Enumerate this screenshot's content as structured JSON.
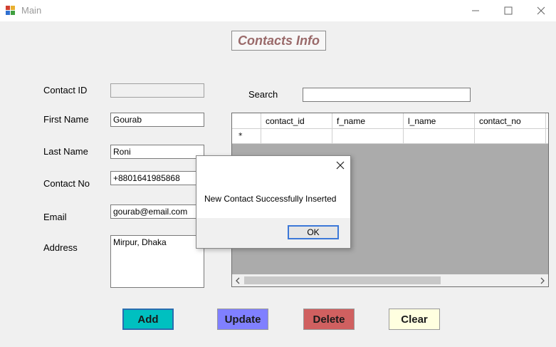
{
  "window": {
    "title": "Main"
  },
  "header": {
    "title": "Contacts Info"
  },
  "form": {
    "contact_id": {
      "label": "Contact ID",
      "value": ""
    },
    "first_name": {
      "label": "First Name",
      "value": "Gourab"
    },
    "last_name": {
      "label": "Last Name",
      "value": "Roni"
    },
    "contact_no": {
      "label": "Contact No",
      "value": "+8801641985868"
    },
    "email": {
      "label": "Email",
      "value": "gourab@email.com"
    },
    "address": {
      "label": "Address",
      "value": "Mirpur, Dhaka"
    }
  },
  "search": {
    "label": "Search",
    "value": ""
  },
  "grid": {
    "columns": [
      "contact_id",
      "f_name",
      "l_name",
      "contact_no"
    ],
    "new_row_marker": "*"
  },
  "dialog": {
    "message": "New Contact Successfully Inserted",
    "ok_label": "OK"
  },
  "buttons": {
    "add": {
      "label": "Add",
      "color": "#00c0c0"
    },
    "update": {
      "label": "Update",
      "color": "#8080ff"
    },
    "delete": {
      "label": "Delete",
      "color": "#d06060"
    },
    "clear": {
      "label": "Clear",
      "color": "#ffffe0"
    }
  }
}
